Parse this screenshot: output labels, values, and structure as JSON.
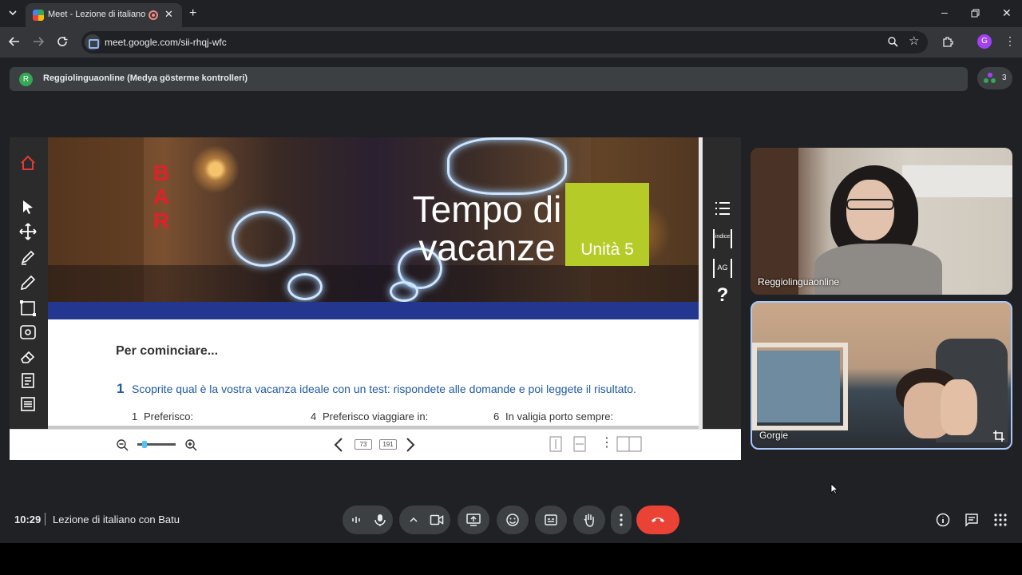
{
  "browser": {
    "tab_title": "Meet - Lezione di italiano c",
    "url": "meet.google.com/sii-rhqj-wfc",
    "profile_initial": "G"
  },
  "meet": {
    "presenter_initial": "R",
    "presenting_label": "Reggiolinguaonline (Medya gösterme kontrolleri)",
    "participant_count": "3",
    "time": "10:29",
    "meeting_title": "Lezione di italiano con Batu"
  },
  "presentation": {
    "banner_sign": [
      "B",
      "A",
      "R"
    ],
    "title_line1": "Tempo di",
    "title_line2": "vacanze",
    "unit": "Unità 5",
    "heading": "Per cominciare...",
    "exercise_number": "1",
    "exercise_text": "Scoprite qual è la vostra vacanza ideale con un test: rispondete alle domande e poi leggete il risultato.",
    "questions": [
      {
        "num": "1",
        "text": "Preferisco:"
      },
      {
        "num": "4",
        "text": "Preferisco viaggiare in:"
      },
      {
        "num": "6",
        "text": "In valigia porto sempre:"
      }
    ],
    "right_tools": {
      "index_label": "indice",
      "ag_label": "AG",
      "help_label": "?"
    },
    "page_current": "73",
    "page_total": "191"
  },
  "participants": [
    {
      "name": "Reggiolinguaonline"
    },
    {
      "name": "Gorgie"
    }
  ],
  "colors": {
    "end_call": "#ea4335",
    "unit_box": "#b5cc28",
    "blue_band": "#24378e",
    "exercise_text": "#1f5aa6"
  }
}
